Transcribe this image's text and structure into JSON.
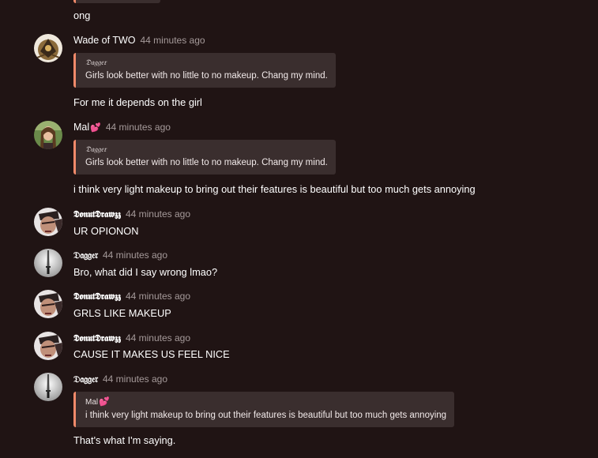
{
  "top": {
    "text": "ong"
  },
  "messages": [
    {
      "author": "Wade of TWO",
      "time": "44 minutes ago",
      "quote": {
        "author": "𝔇𝔞𝔤𝔤𝔢𝔯",
        "text": "Girls look better with no little to no makeup. Chang my mind."
      },
      "text": "For me it depends on the girl"
    },
    {
      "author": "Mal",
      "author_emoji": "💕",
      "time": "44 minutes ago",
      "quote": {
        "author": "𝔇𝔞𝔤𝔤𝔢𝔯",
        "text": "Girls look better with no little to no makeup. Chang my mind."
      },
      "text": "i think very light makeup to bring out their features is beautiful but too much gets annoying"
    },
    {
      "author": "𝕯𝖔𝖓𝖚𝖙𝕯𝖗𝖆𝖜𝖟𝖟",
      "time": "44 minutes ago",
      "text": "UR OPIONON"
    },
    {
      "author": "𝔇𝔞𝔤𝔤𝔢𝔯",
      "time": "44 minutes ago",
      "text": "Bro, what did I say wrong lmao?"
    },
    {
      "author": "𝕯𝖔𝖓𝖚𝖙𝕯𝖗𝖆𝖜𝖟𝖟",
      "time": "44 minutes ago",
      "text": "GRLS LIKE MAKEUP"
    },
    {
      "author": "𝕯𝖔𝖓𝖚𝖙𝕯𝖗𝖆𝖜𝖟𝖟",
      "time": "44 minutes ago",
      "text": "CAUSE IT MAKES US FEEL NICE"
    },
    {
      "author": "𝔇𝔞𝔤𝔤𝔢𝔯",
      "time": "44 minutes ago",
      "quote": {
        "author": "Mal",
        "author_emoji": "💕",
        "text": "i think very light makeup to bring out their features is beautiful but too much gets annoying"
      },
      "text": "That's what I'm saying."
    }
  ],
  "colors": {
    "background": "#201414",
    "quote_background": "#3a2e2e",
    "quote_accent": "#f08a6a",
    "timestamp": "#a59a9a"
  },
  "avatars": [
    "wade-avatar",
    "mal-avatar",
    "donut-avatar",
    "dagger-avatar"
  ]
}
